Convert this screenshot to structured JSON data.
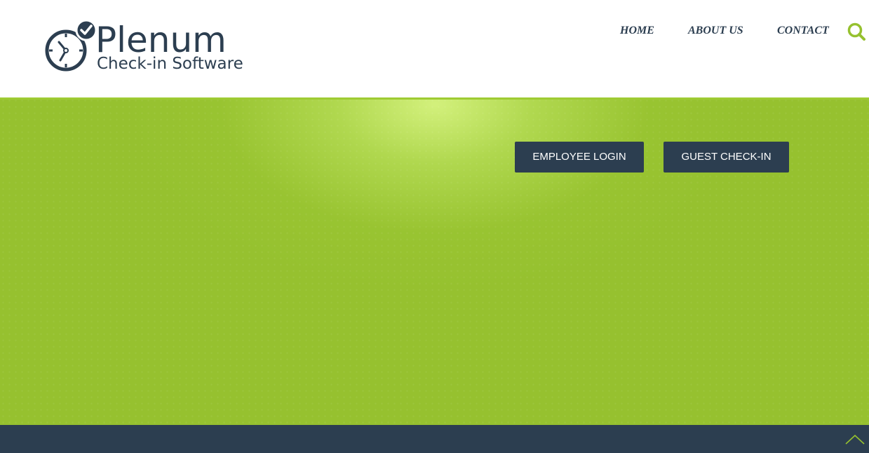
{
  "header": {
    "logo": {
      "name": "Plenum",
      "tagline": "Check-in Software"
    },
    "nav": [
      {
        "label": "HOME"
      },
      {
        "label": "ABOUT US"
      },
      {
        "label": "CONTACT"
      }
    ],
    "search_icon": "search-icon"
  },
  "hero": {
    "buttons": [
      {
        "label": "EMPLOYEE LOGIN"
      },
      {
        "label": "GUEST CHECK-IN"
      }
    ]
  },
  "footer": {
    "back_to_top_icon": "chevron-up-icon"
  },
  "colors": {
    "brand_navy": "#2c3e50",
    "brand_green": "#96c12f",
    "white": "#ffffff"
  }
}
